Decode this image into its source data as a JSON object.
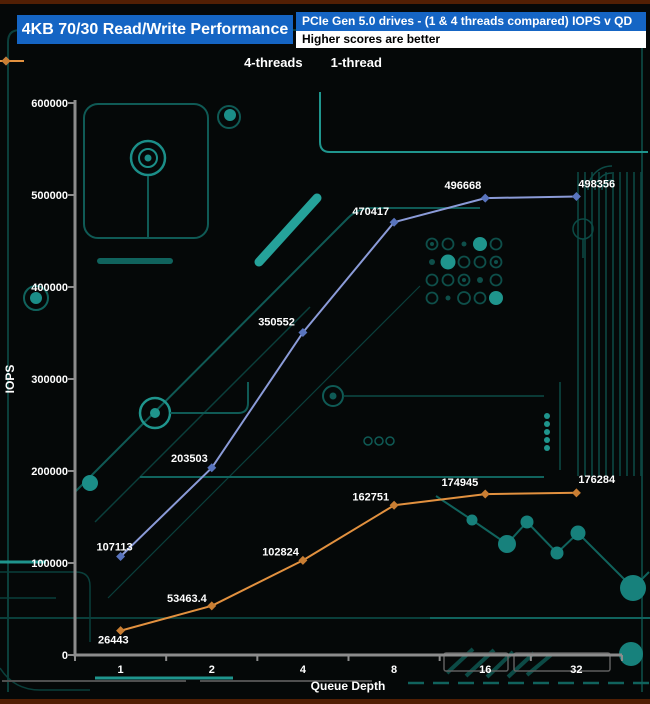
{
  "header": {
    "title": "4KB 70/30 Read/Write Performance",
    "subtitle": "PCIe Gen 5.0 drives - (1 & 4 threads compared) IOPS v QD",
    "note": "Higher scores are better"
  },
  "colors": {
    "title_bg": "#1565c4",
    "title_text": "#ffffff",
    "note_bg": "#ffffff",
    "note_text": "#000000",
    "axis": "#8c8c8c",
    "label_text": "#ffffff",
    "background": "#050808",
    "circuit_dark": "#0c4a45",
    "circuit_mid": "#10635d",
    "circuit_bright": "#1f958d",
    "edge_strip": "#511f04",
    "series_4threads": "#8b9bd8",
    "series_4threads_marker": "#5974bd",
    "series_1thread": "#e2913f",
    "series_1thread_marker": "#c97e33"
  },
  "chart_data": {
    "type": "line",
    "title": "4KB 70/30 Read/Write Performance",
    "subtitle": "PCIe Gen 5.0 drives - (1 & 4 threads compared) IOPS v QD",
    "note": "Higher scores are better",
    "xlabel": "Queue Depth",
    "ylabel": "IOPS",
    "categories": [
      "1",
      "2",
      "4",
      "8",
      "16",
      "32"
    ],
    "series": [
      {
        "name": "4-threads",
        "color": "#8b9bd8",
        "marker_color": "#5974bd",
        "values": [
          107113,
          203503,
          350552,
          470417,
          496668,
          498356
        ],
        "labels": [
          "107113",
          "203503",
          "350552",
          "470417",
          "496668",
          "498356"
        ]
      },
      {
        "name": "1-thread",
        "color": "#e2913f",
        "marker_color": "#c97e33",
        "values": [
          26443,
          53463.4,
          102824,
          162751,
          174945,
          176284
        ],
        "labels": [
          "26443",
          "53463.4",
          "102824",
          "162751",
          "174945",
          "176284"
        ]
      }
    ],
    "ylim": [
      0,
      600000
    ],
    "ytick_step": 100000,
    "yticks": [
      0,
      100000,
      200000,
      300000,
      400000,
      500000,
      600000
    ],
    "grid": false,
    "legend_position": "top"
  }
}
